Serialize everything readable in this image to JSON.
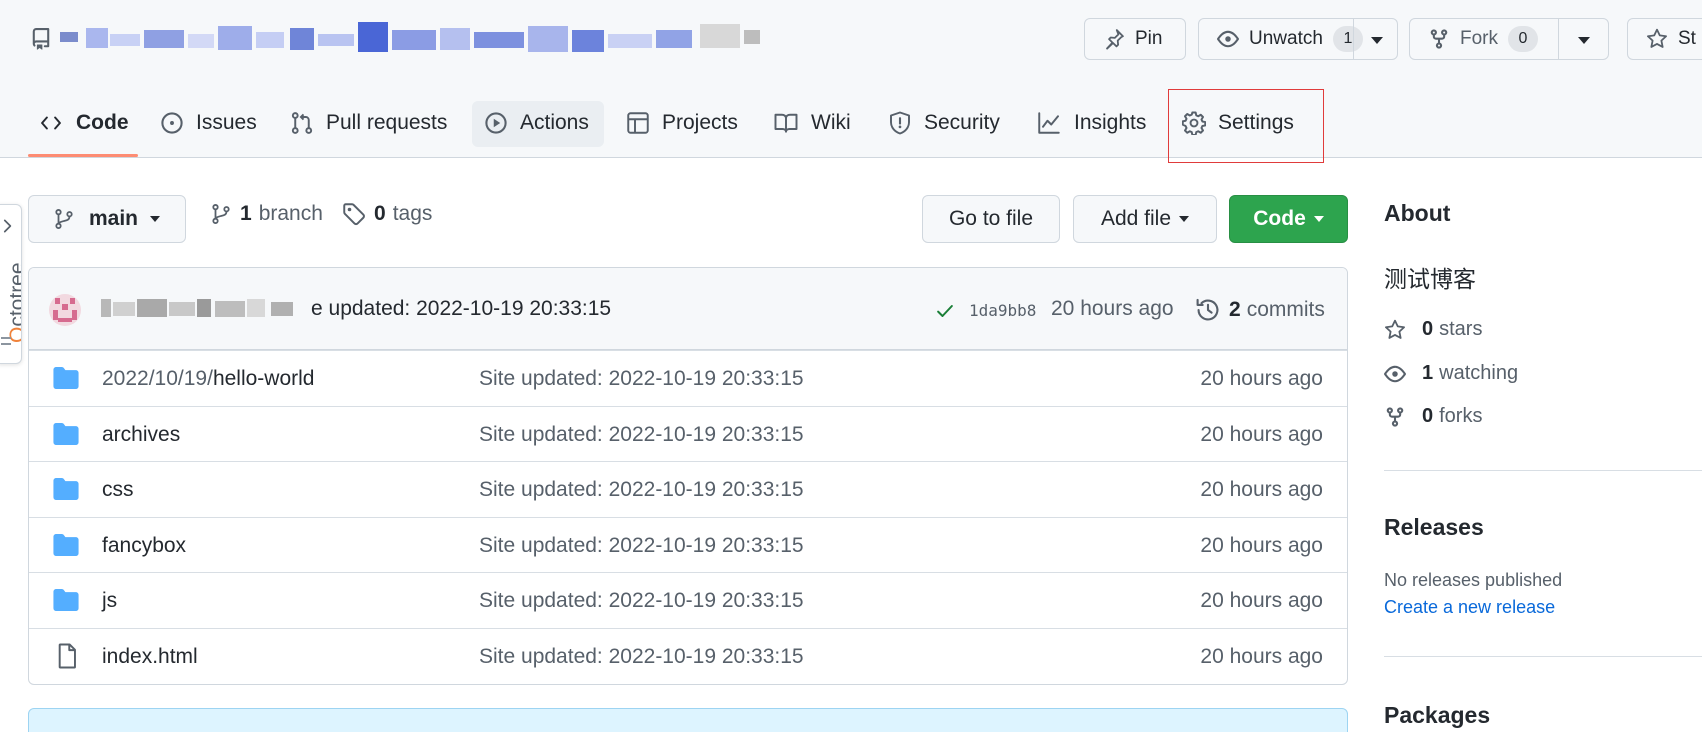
{
  "header": {
    "pin": {
      "label": "Pin"
    },
    "unwatch": {
      "label": "Unwatch",
      "count": "1"
    },
    "fork": {
      "label": "Fork",
      "count": "0"
    },
    "star": {
      "label": "St"
    }
  },
  "tabs": [
    {
      "label": "Code",
      "icon": "code-icon",
      "selected": true
    },
    {
      "label": "Issues",
      "icon": "issue-opened-icon"
    },
    {
      "label": "Pull requests",
      "icon": "git-pull-request-icon"
    },
    {
      "label": "Actions",
      "icon": "play-icon"
    },
    {
      "label": "Projects",
      "icon": "table-icon"
    },
    {
      "label": "Wiki",
      "icon": "book-icon"
    },
    {
      "label": "Security",
      "icon": "shield-icon"
    },
    {
      "label": "Insights",
      "icon": "graph-icon"
    },
    {
      "label": "Settings",
      "icon": "gear-icon"
    }
  ],
  "toolbar": {
    "branch": "main",
    "branches_count": "1",
    "branches_label": "branch",
    "tags_count": "0",
    "tags_label": "tags",
    "go_to_file": "Go to file",
    "add_file": "Add file",
    "code": "Code"
  },
  "latest_commit": {
    "message_suffix": "e updated: 2022-10-19 20:33:15",
    "sha": "1da9bb8",
    "age": "20 hours ago",
    "commits_count": "2",
    "commits_label": "commits"
  },
  "files": [
    {
      "type": "folder",
      "name_prefix": "2022/10/19/",
      "name": "hello-world",
      "message": "Site updated: 2022-10-19 20:33:15",
      "age": "20 hours ago"
    },
    {
      "type": "folder",
      "name_prefix": "",
      "name": "archives",
      "message": "Site updated: 2022-10-19 20:33:15",
      "age": "20 hours ago"
    },
    {
      "type": "folder",
      "name_prefix": "",
      "name": "css",
      "message": "Site updated: 2022-10-19 20:33:15",
      "age": "20 hours ago"
    },
    {
      "type": "folder",
      "name_prefix": "",
      "name": "fancybox",
      "message": "Site updated: 2022-10-19 20:33:15",
      "age": "20 hours ago"
    },
    {
      "type": "folder",
      "name_prefix": "",
      "name": "js",
      "message": "Site updated: 2022-10-19 20:33:15",
      "age": "20 hours ago"
    },
    {
      "type": "file",
      "name_prefix": "",
      "name": "index.html",
      "message": "Site updated: 2022-10-19 20:33:15",
      "age": "20 hours ago"
    }
  ],
  "octotree": {
    "label_first": "O",
    "label_rest": "ctotree"
  },
  "sidebar": {
    "about_title": "About",
    "description": "测试博客",
    "stars_count": "0",
    "stars_label": "stars",
    "watching_count": "1",
    "watching_label": "watching",
    "forks_count": "0",
    "forks_label": "forks",
    "releases_title": "Releases",
    "releases_none": "No releases published",
    "create_release": "Create a new release",
    "packages_title": "Packages"
  },
  "colors": {
    "accent_green": "#2da44e",
    "tab_underline": "#fd8c73",
    "folder_blue": "#54aeff",
    "link_blue": "#0969da",
    "highlight_red": "#e03b3b"
  }
}
